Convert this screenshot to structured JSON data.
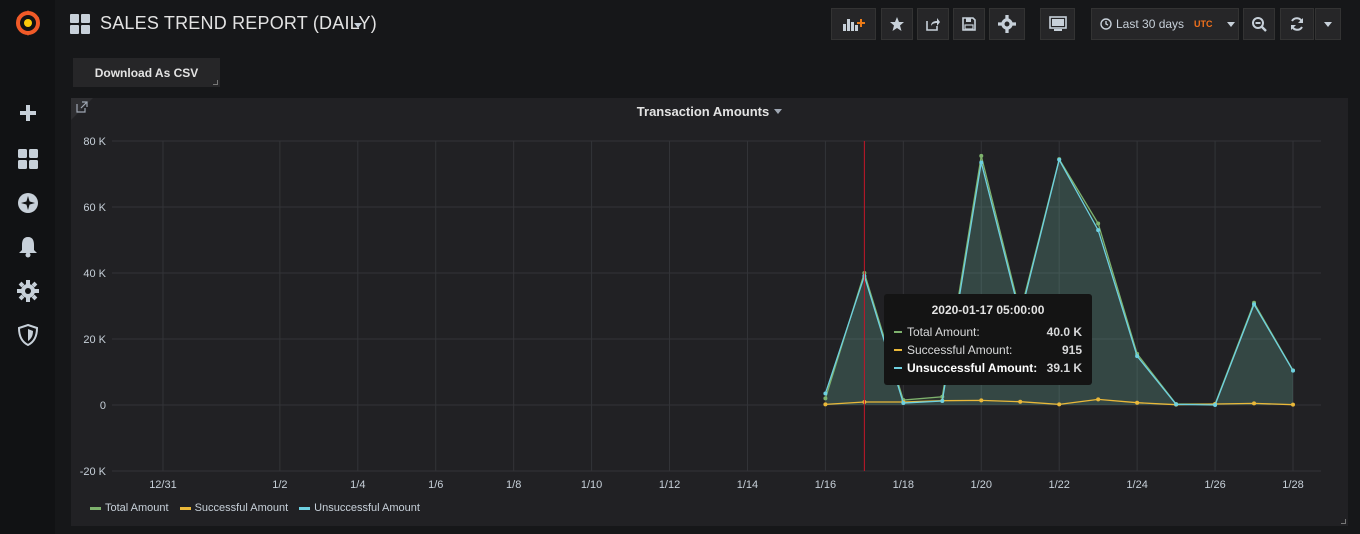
{
  "sidebar": {
    "items": [
      {
        "icon": "grafana-logo-icon"
      },
      {
        "icon": "plus-icon"
      },
      {
        "icon": "dashboards-icon"
      },
      {
        "icon": "explore-icon"
      },
      {
        "icon": "alert-bell-icon"
      },
      {
        "icon": "configuration-gear-icon"
      },
      {
        "icon": "shield-icon"
      }
    ]
  },
  "header": {
    "title": "SALES TREND REPORT (DAILY)",
    "time_range": "Last 30 days",
    "timezone": "UTC"
  },
  "toolbar": {
    "csv_label": "Download As CSV"
  },
  "panel": {
    "title": "Transaction Amounts"
  },
  "tooltip": {
    "time": "2020-01-17 05:00:00",
    "rows": [
      {
        "label": "Total Amount:",
        "value": "40.0 K"
      },
      {
        "label": "Successful Amount:",
        "value": "915"
      },
      {
        "label": "Unsuccessful Amount:",
        "value": "39.1 K"
      }
    ]
  },
  "colors": {
    "total": "#7eb26d",
    "successful": "#eab839",
    "unsuccessful": "#6ed0e0",
    "timezone": "#f2711c",
    "crosshair": "#c4162a"
  },
  "chart_data": {
    "type": "line",
    "x": [
      "1/16",
      "1/17",
      "1/18",
      "1/19",
      "1/20",
      "1/21",
      "1/22",
      "1/23",
      "1/24",
      "1/25",
      "1/26",
      "1/27",
      "1/28"
    ],
    "x_ticks": [
      "12/31",
      "1/2",
      "1/4",
      "1/6",
      "1/8",
      "1/10",
      "1/12",
      "1/14",
      "1/16",
      "1/18",
      "1/20",
      "1/22",
      "1/24",
      "1/26",
      "1/28"
    ],
    "y_ticks": [
      "80 K",
      "60 K",
      "40 K",
      "20 K",
      "0",
      "-20 K"
    ],
    "ylim": [
      -20000,
      80000
    ],
    "xlim": [
      "12/30",
      "1/28"
    ],
    "series": [
      {
        "name": "Total Amount",
        "values": [
          2000,
          40000,
          1500,
          2500,
          75500,
          28000,
          74500,
          55000,
          15500,
          300,
          300,
          31000,
          10500
        ]
      },
      {
        "name": "Successful Amount",
        "values": [
          200,
          915,
          900,
          1300,
          1400,
          1000,
          200,
          1700,
          700,
          100,
          300,
          500,
          100
        ]
      },
      {
        "name": "Unsuccessful Amount",
        "values": [
          3500,
          39100,
          600,
          1200,
          73500,
          27000,
          74300,
          53000,
          14800,
          200,
          0,
          30500,
          10400
        ]
      }
    ],
    "crosshair_x": "1/17",
    "grid": true,
    "legend": "bottom-left"
  }
}
